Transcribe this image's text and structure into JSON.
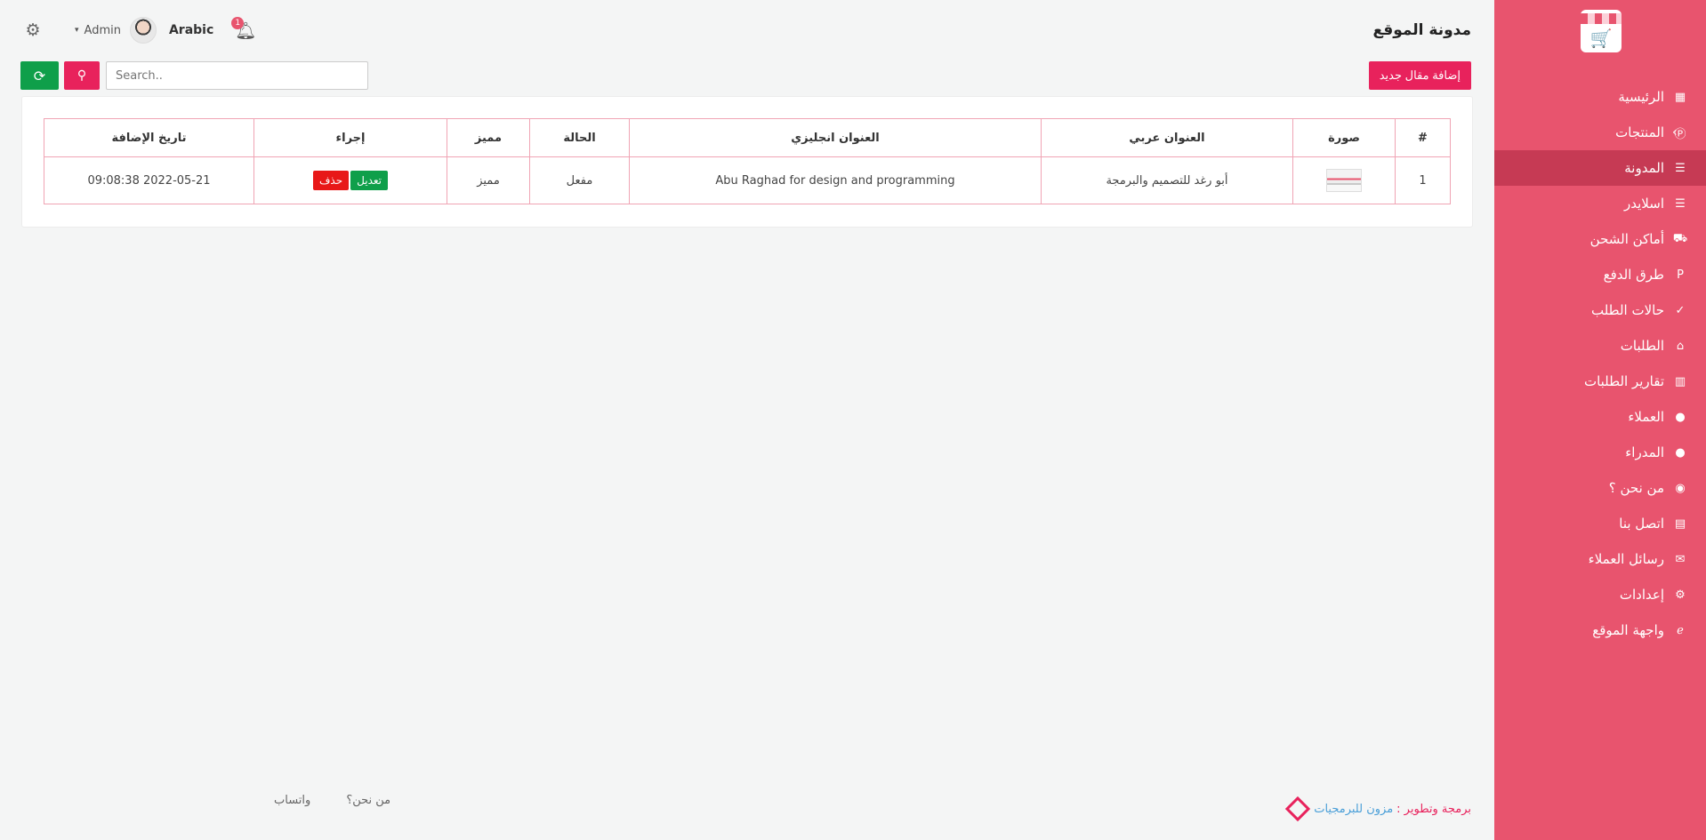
{
  "sidebar": {
    "items": [
      {
        "label": "الرئيسية",
        "icon": "dashboard-icon",
        "glyph": "▦"
      },
      {
        "label": "المنتجات",
        "icon": "products-icon",
        "glyph": "Ⓟ",
        "has_children": true
      },
      {
        "label": "المدونة",
        "icon": "sliders-icon",
        "glyph": "☰",
        "active": true
      },
      {
        "label": "اسلايدر",
        "icon": "sliders-icon",
        "glyph": "☰"
      },
      {
        "label": "أماكن الشحن",
        "icon": "truck-icon",
        "glyph": "⛟"
      },
      {
        "label": "طرق الدفع",
        "icon": "paypal-icon",
        "glyph": "P"
      },
      {
        "label": "حالات الطلب",
        "icon": "check-circle-icon",
        "glyph": "✓"
      },
      {
        "label": "الطلبات",
        "icon": "basket-icon",
        "glyph": "⌂"
      },
      {
        "label": "تقارير الطلبات",
        "icon": "chart-icon",
        "glyph": "▥"
      },
      {
        "label": "العملاء",
        "icon": "user-icon",
        "glyph": "●"
      },
      {
        "label": "المدراء",
        "icon": "user-icon",
        "glyph": "●"
      },
      {
        "label": "من نحن ؟",
        "icon": "eye-icon",
        "glyph": "◉"
      },
      {
        "label": "اتصل بنا",
        "icon": "contact-card-icon",
        "glyph": "▤"
      },
      {
        "label": "رسائل العملاء",
        "icon": "envelope-icon",
        "glyph": "✉"
      },
      {
        "label": "إعدادات",
        "icon": "gear-icon",
        "glyph": "⚙"
      },
      {
        "label": "واجهة الموقع",
        "icon": "browser-icon",
        "glyph": "ℯ"
      }
    ]
  },
  "header": {
    "title": "مدونة الموقع",
    "language": "Arabic",
    "user": "Admin",
    "notifications": "1"
  },
  "toolbar": {
    "add_label": "إضافة مقال جديد",
    "search_placeholder": "Search.."
  },
  "table": {
    "columns": [
      "#",
      "صورة",
      "العنوان عربي",
      "العنوان انجليزي",
      "الحالة",
      "مميز",
      "إجراء",
      "تاريخ الإضافة"
    ],
    "rows": [
      {
        "num": "1",
        "title_ar": "أبو رغد للتصميم والبرمجة",
        "title_en": "Abu Raghad for design and programming",
        "status": "مفعل",
        "featured": "مميز",
        "edit": "تعديل",
        "delete": "حذف",
        "date": "2022-05-21 09:08:38"
      }
    ]
  },
  "footer": {
    "dev_label": "برمجة وتطوير :",
    "brand": "مزون للبرمجيات",
    "links": [
      "من نحن؟",
      "واتساب"
    ]
  },
  "colors": {
    "sidebar": "#e8546e",
    "sidebar_active": "#c63a54",
    "primary": "#e8225c",
    "success": "#0f9f4a",
    "danger": "#e81818"
  }
}
